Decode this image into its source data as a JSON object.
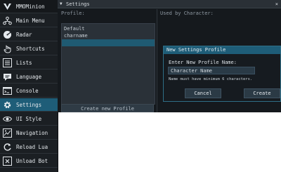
{
  "menu": {
    "items": [
      {
        "label": "MMOMinion",
        "icon": "minion-logo-icon"
      },
      {
        "label": "Main Menu",
        "icon": "network-icon"
      },
      {
        "label": "Radar",
        "icon": "radar-icon"
      },
      {
        "label": "Shortcuts",
        "icon": "hand-pointer-icon"
      },
      {
        "label": "Lists",
        "icon": "list-icon"
      },
      {
        "label": "Language",
        "icon": "speech-icon"
      },
      {
        "label": "Console",
        "icon": "console-icon"
      },
      {
        "label": "Settings",
        "icon": "gear-icon"
      },
      {
        "label": "UI Style",
        "icon": "eye-icon"
      },
      {
        "label": "Navigation",
        "icon": "navigation-icon"
      },
      {
        "label": "Reload Lua",
        "icon": "reload-icon"
      },
      {
        "label": "Unload Bot",
        "icon": "close-box-icon"
      }
    ],
    "active_index": 7
  },
  "settings_window": {
    "title": "Settings",
    "close_glyph": "×",
    "profile_header": "Profile:",
    "used_by_header": "Used by Character:",
    "profiles": [
      "Default",
      "charname"
    ],
    "create_button": "Create new Profile"
  },
  "dialog": {
    "title": "New Settings Profile",
    "label": "Enter New Profile Name:",
    "input_value": "Character Name",
    "hint": "Name must have minimum 6 characters.",
    "cancel": "Cancel",
    "create": "Create"
  },
  "colors": {
    "accent": "#1e5d78",
    "menu_bg": "#1b1f23",
    "window_bg": "#15191d"
  }
}
